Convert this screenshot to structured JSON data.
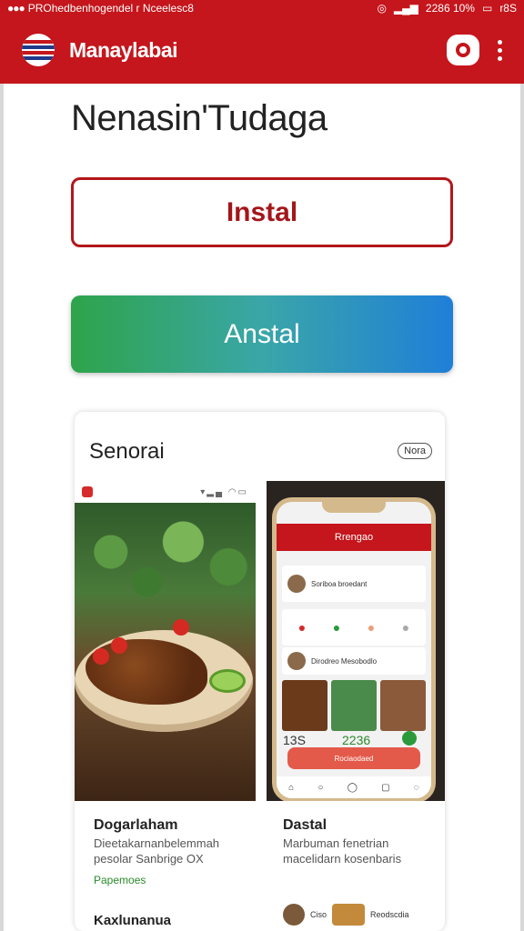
{
  "status_bar": {
    "left_text": "PROhedbenhogendel r Nceelesc8",
    "right_text": "2286 10%",
    "battery_label": "r8S"
  },
  "app_bar": {
    "title": "Manaylabai"
  },
  "headline": "Nenasin'Tudaga",
  "buttons": {
    "primary_outline": "Instal",
    "primary_gradient": "Anstal"
  },
  "screenshots_card": {
    "title": "Senorai",
    "pill": "Nora",
    "shot1": {
      "caption_title": "Dogarlaham",
      "caption_desc_1": "Dieetakarnanbelemmah",
      "caption_desc_2": "pesolar Sanbrige OX",
      "caption_link": "Papemoes"
    },
    "shot2": {
      "phone_header": "Rrengao",
      "row1_name": "Soriboa broedant",
      "row2_name": "Dirodreo Mesobodlo",
      "cta": "Rociaodaed",
      "caption_title": "Dastal",
      "caption_desc_1": "Marbuman fenetrian",
      "caption_desc_2": "macelidarn kosenbaris",
      "stat_left": "13S",
      "stat_mid": "2236",
      "thumb_label_1": "Ciso",
      "thumb_label_2": "Reodscdia"
    },
    "bottom_item": "Kaxlunanua"
  },
  "colors": {
    "brand_red": "#c4161c",
    "green": "#2ea44a",
    "blue": "#1f7fd8"
  }
}
